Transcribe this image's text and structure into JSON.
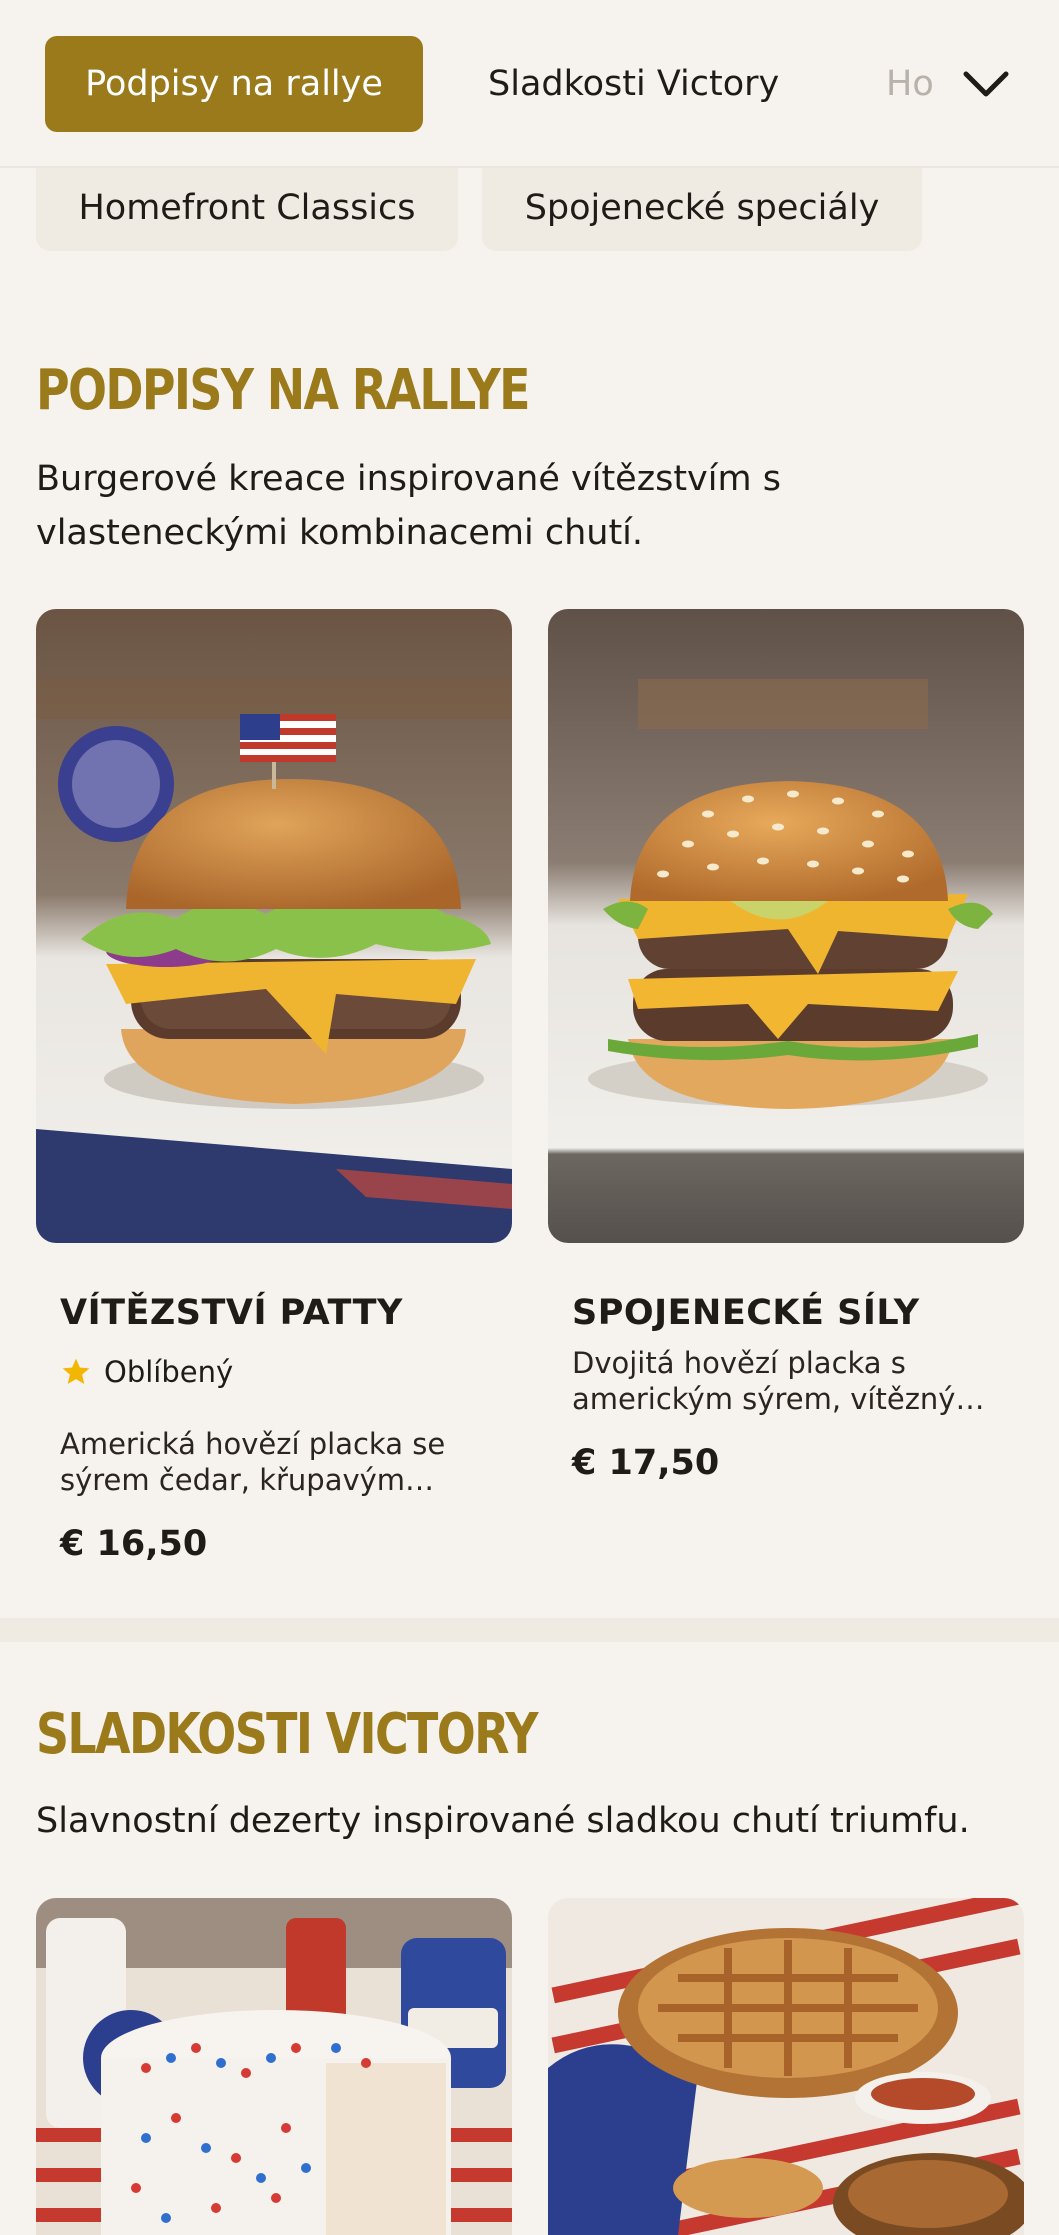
{
  "nav": {
    "tabs": [
      {
        "label": "Podpisy na rallye",
        "active": true
      },
      {
        "label": "Sladkosti Victory",
        "active": false
      },
      {
        "label": "Ho",
        "active": false
      }
    ],
    "more_icon": "chevron-down-icon"
  },
  "chips": [
    {
      "label": "Homefront Classics"
    },
    {
      "label": "Spojenecké speciály"
    }
  ],
  "sections": [
    {
      "title": "PODPISY NA RALLYE",
      "description": "Burgerové kreace inspirované vítězstvím s vlasteneckými kombinacemi chutí.",
      "items": [
        {
          "name": "VÍTĚZSTVÍ PATTY",
          "badge": "Oblíbený",
          "badge_icon": "star-icon",
          "description": "Americká hovězí placka se sýrem čedar, křupavým salátem, rajčaty a cibulí v máslové housce.",
          "price": "€ 16,50"
        },
        {
          "name": "SPOJENECKÉ SÍLY",
          "description": "Dvojitá hovězí placka s americkým sýrem, vítězným dresinkem a salátem v sezamové housce.",
          "price": "€ 17,50"
        }
      ]
    },
    {
      "title": "SLADKOSTI VICTORY",
      "description": "Slavnostní dezerty inspirované sladkou chutí triumfu."
    }
  ],
  "colors": {
    "accent": "#9b7a1c",
    "background": "#f6f3ee",
    "chip_background": "#efebe3",
    "text": "#1f1b16",
    "star": "#f2b705"
  }
}
